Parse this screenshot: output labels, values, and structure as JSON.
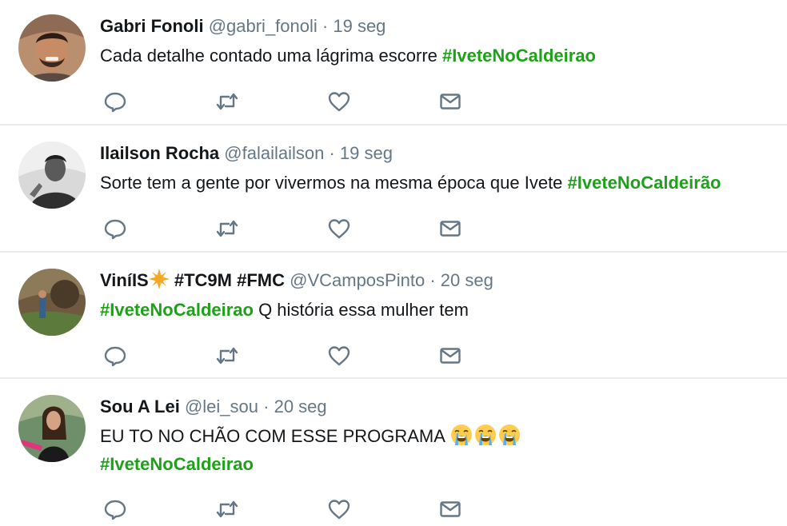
{
  "tweets": [
    {
      "name": "Gabri Fonoli",
      "handle": "@gabri_fonoli",
      "separator": "·",
      "time": "19 seg",
      "text_before": "Cada detalhe contado uma lágrima escorre ",
      "hashtag": "#IveteNoCaldeirao"
    },
    {
      "name": "Ilailson Rocha",
      "handle": "@falailailson",
      "separator": "·",
      "time": "19 seg",
      "text_before": "Sorte tem a gente por vivermos na mesma época que Ivete ",
      "hashtag": "#IveteNoCaldeirão"
    },
    {
      "name": "ViníIS",
      "name_suffix": "#TC9M #FMC",
      "handle": "@VCamposPinto",
      "separator": "·",
      "time": "20 seg",
      "hashtag": "#IveteNoCaldeirao",
      "text_after": " Q história essa mulher tem"
    },
    {
      "name": "Sou A Lei",
      "handle": "@lei_sou",
      "separator": "·",
      "time": "20 seg",
      "text_before": "EU TO NO CHÃO COM ESSE PROGRAMA ",
      "emoji": "loudly-crying-face",
      "emoji_count": 3,
      "hashtag": "#IveteNoCaldeirao"
    }
  ],
  "actions": [
    "reply-icon",
    "retweet-icon",
    "like-icon",
    "direct-message-icon"
  ],
  "colors": {
    "hashtag": "#1da118",
    "meta": "#657786",
    "icon": "#657786",
    "divider": "#e6ecf0"
  }
}
